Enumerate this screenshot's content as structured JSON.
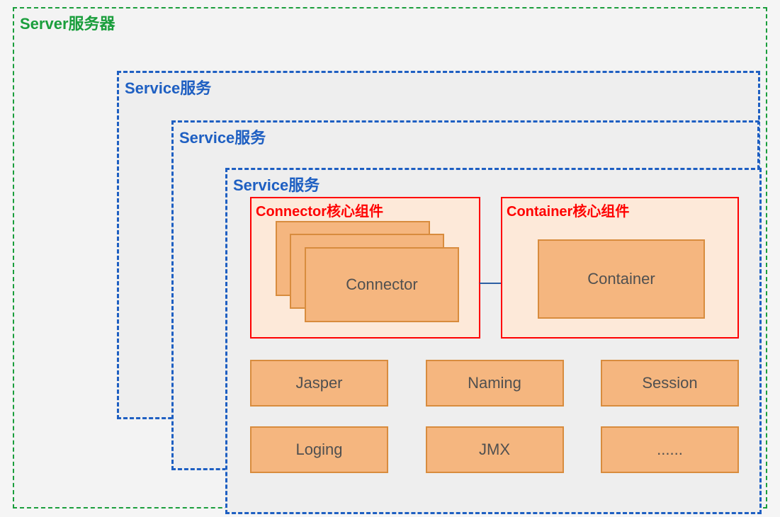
{
  "server": {
    "label": "Server服务器"
  },
  "services": {
    "label1": "Service服务",
    "label2": "Service服务",
    "label3": "Service服务"
  },
  "cores": {
    "connector": {
      "title": "Connector核心组件",
      "box": "Connector"
    },
    "container": {
      "title": "Container核心组件",
      "box": "Container"
    }
  },
  "components": {
    "row1": {
      "a": "Jasper",
      "b": "Naming",
      "c": "Session"
    },
    "row2": {
      "a": "Loging",
      "b": "JMX",
      "c": "......"
    }
  }
}
